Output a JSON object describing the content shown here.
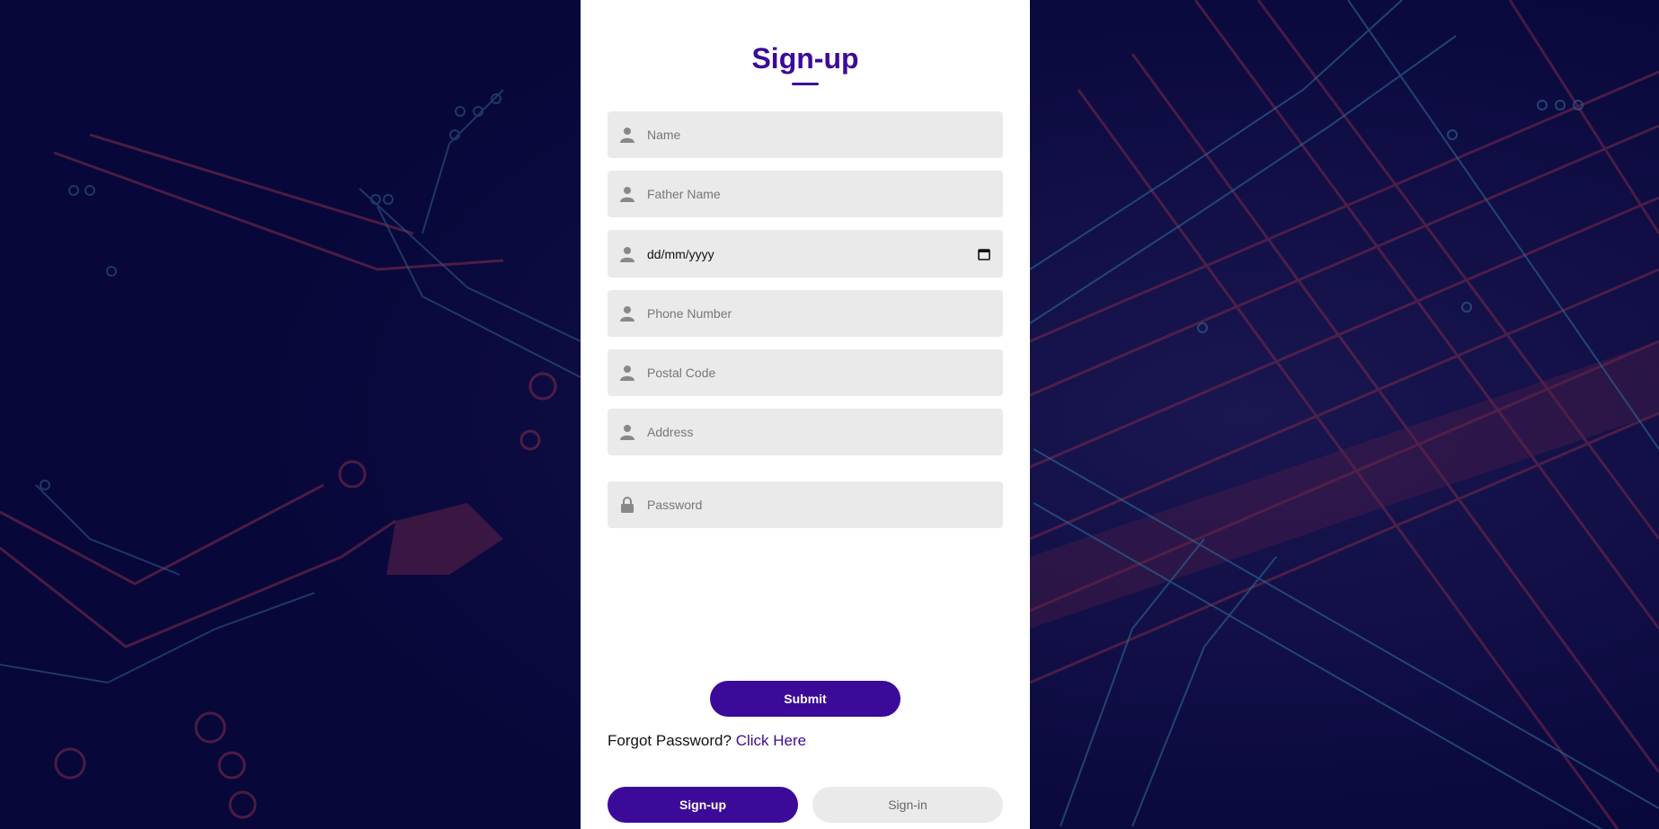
{
  "form": {
    "title": "Sign-up",
    "fields": [
      {
        "name": "name-input",
        "icon": "user-icon",
        "placeholder": "Name"
      },
      {
        "name": "father-name-input",
        "icon": "user-icon",
        "placeholder": "Father Name"
      },
      {
        "name": "dob-input",
        "icon": "user-icon",
        "value": "dd/mm/yyyy"
      },
      {
        "name": "phone-input",
        "icon": "user-icon",
        "placeholder": "Phone Number"
      },
      {
        "name": "postal-code-input",
        "icon": "user-icon",
        "placeholder": "Postal Code"
      },
      {
        "name": "address-input",
        "icon": "user-icon",
        "placeholder": "Address"
      },
      {
        "name": "password-input",
        "icon": "lock-icon",
        "placeholder": "Password"
      }
    ],
    "submit_label": "Submit",
    "forgot_text": "Forgot Password?",
    "forgot_link": "Click Here"
  },
  "tabs": {
    "signup_label": "Sign-up",
    "signin_label": "Sign-in"
  },
  "colors": {
    "accent": "#3c0a99",
    "field_bg": "#eaeaea",
    "page_bg": "#0a0a3a"
  }
}
